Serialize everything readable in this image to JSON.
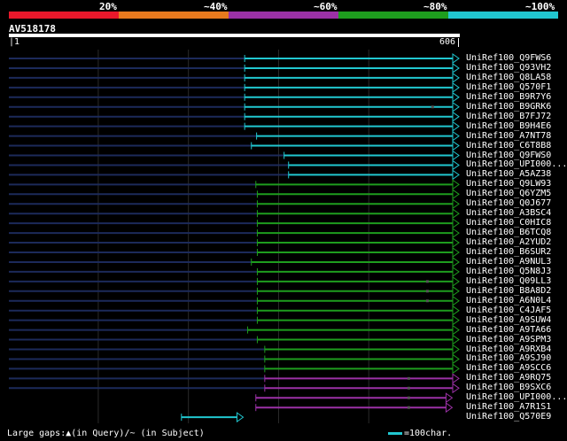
{
  "scale": {
    "labels": [
      "20%",
      "~40%",
      "~60%",
      "~80%",
      "~100%"
    ],
    "colors": [
      "#e8182b",
      "#e87a1e",
      "#9b31a6",
      "#1e9d1e",
      "#21c7d0"
    ]
  },
  "query": {
    "name": "AV518178",
    "length": 606,
    "start_label": "1",
    "end_label": "606"
  },
  "hits": [
    {
      "name": "UniRef100_Q9FWS6",
      "color": "#21c7d0",
      "start": 318,
      "gap": null
    },
    {
      "name": "UniRef100_Q93VH2",
      "color": "#21c7d0",
      "start": 318,
      "gap": null
    },
    {
      "name": "UniRef100_Q8LA58",
      "color": "#21c7d0",
      "start": 318,
      "gap": null
    },
    {
      "name": "UniRef100_Q570F1",
      "color": "#21c7d0",
      "start": 318,
      "gap": null
    },
    {
      "name": "UniRef100_B9R7Y6",
      "color": "#21c7d0",
      "start": 318,
      "gap": null
    },
    {
      "name": "UniRef100_B9GRK6",
      "color": "#21c7d0",
      "start": 318,
      "gap": 570
    },
    {
      "name": "UniRef100_B7FJ72",
      "color": "#21c7d0",
      "start": 318,
      "gap": null
    },
    {
      "name": "UniRef100_B9H4E6",
      "color": "#21c7d0",
      "start": 318,
      "gap": null
    },
    {
      "name": "UniRef100_A7NT78",
      "color": "#21c7d0",
      "start": 334,
      "gap": null
    },
    {
      "name": "UniRef100_C6T8B8",
      "color": "#21c7d0",
      "start": 327,
      "gap": null
    },
    {
      "name": "UniRef100_Q9FWS0",
      "color": "#21c7d0",
      "start": 371,
      "gap": null
    },
    {
      "name": "UniRef100_UPI000...",
      "color": "#21c7d0",
      "start": 377,
      "gap": null
    },
    {
      "name": "UniRef100_A5AZ38",
      "color": "#21c7d0",
      "start": 377,
      "gap": null
    },
    {
      "name": "UniRef100_Q9LW93",
      "color": "#1e9d1e",
      "start": 333,
      "gap": null
    },
    {
      "name": "UniRef100_Q6YZM5",
      "color": "#1e9d1e",
      "start": 335,
      "gap": null
    },
    {
      "name": "UniRef100_Q0J677",
      "color": "#1e9d1e",
      "start": 335,
      "gap": null
    },
    {
      "name": "UniRef100_A3BSC4",
      "color": "#1e9d1e",
      "start": 335,
      "gap": null
    },
    {
      "name": "UniRef100_C0HIC8",
      "color": "#1e9d1e",
      "start": 335,
      "gap": null
    },
    {
      "name": "UniRef100_B6TCQ8",
      "color": "#1e9d1e",
      "start": 335,
      "gap": null
    },
    {
      "name": "UniRef100_A2YUD2",
      "color": "#1e9d1e",
      "start": 335,
      "gap": null
    },
    {
      "name": "UniRef100_B6SUR2",
      "color": "#1e9d1e",
      "start": 335,
      "gap": null
    },
    {
      "name": "UniRef100_A9NUL3",
      "color": "#1e9d1e",
      "start": 327,
      "gap": null
    },
    {
      "name": "UniRef100_Q5N8J3",
      "color": "#1e9d1e",
      "start": 335,
      "gap": null
    },
    {
      "name": "UniRef100_Q09LL3",
      "color": "#1e9d1e",
      "start": 335,
      "gap": 563
    },
    {
      "name": "UniRef100_B8A8D2",
      "color": "#1e9d1e",
      "start": 335,
      "gap": 563
    },
    {
      "name": "UniRef100_A6N0L4",
      "color": "#1e9d1e",
      "start": 335,
      "gap": 563
    },
    {
      "name": "UniRef100_C4JAF5",
      "color": "#1e9d1e",
      "start": 335,
      "gap": null
    },
    {
      "name": "UniRef100_A9SUW4",
      "color": "#1e9d1e",
      "start": 335,
      "gap": null
    },
    {
      "name": "UniRef100_A9TA66",
      "color": "#1e9d1e",
      "start": 322,
      "gap": null
    },
    {
      "name": "UniRef100_A9SPM3",
      "color": "#1e9d1e",
      "start": 335,
      "gap": null
    },
    {
      "name": "UniRef100_A9RXB4",
      "color": "#1e9d1e",
      "start": 345,
      "gap": null
    },
    {
      "name": "UniRef100_A9SJ90",
      "color": "#1e9d1e",
      "start": 345,
      "gap": null
    },
    {
      "name": "UniRef100_A9SCC6",
      "color": "#1e9d1e",
      "start": 345,
      "gap": null
    },
    {
      "name": "UniRef100_A9RQ75",
      "color": "#9b31a6",
      "start": 345,
      "gap": 538
    },
    {
      "name": "UniRef100_B9SXC6",
      "color": "#9b31a6",
      "start": 345,
      "gap": 538
    },
    {
      "name": "UniRef100_UPI000...",
      "color": "#9b31a6",
      "start": 333,
      "gap": 538,
      "end": 597
    },
    {
      "name": "UniRef100_A7R1S1",
      "color": "#9b31a6",
      "start": 333,
      "gap": 538,
      "end": 597
    },
    {
      "name": "UniRef100_Q570E9",
      "color": "#21c7d0",
      "start": 233,
      "gap": null,
      "end": 316
    }
  ],
  "footer": {
    "gaps_text": "Large gaps:▲(in Query)/~ (in Subject)",
    "legend_text": "=100char."
  }
}
